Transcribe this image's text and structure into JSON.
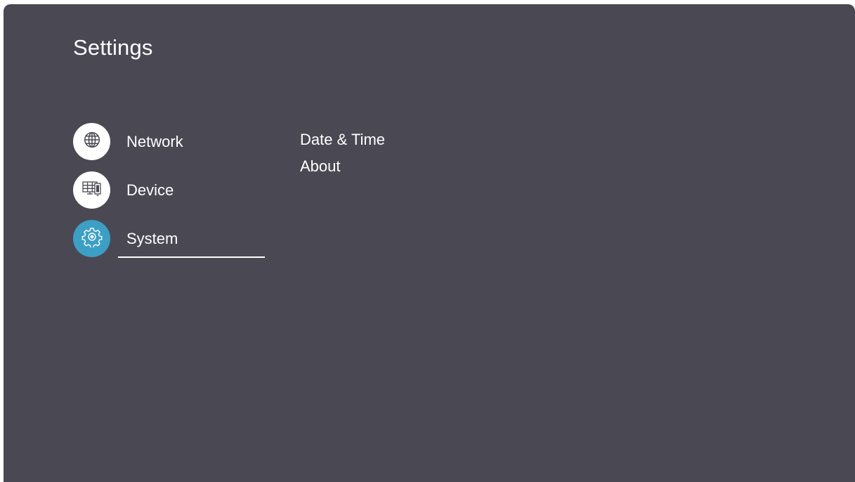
{
  "header": {
    "title": "Settings"
  },
  "nav": {
    "items": [
      {
        "label": "Network",
        "icon": "globe-icon",
        "active": false
      },
      {
        "label": "Device",
        "icon": "display-device-icon",
        "active": false
      },
      {
        "label": "System",
        "icon": "gear-icon",
        "active": true
      }
    ]
  },
  "submenu": {
    "items": [
      {
        "label": "Date & Time"
      },
      {
        "label": "About"
      }
    ]
  },
  "colors": {
    "background": "#4a4953",
    "accent": "#3c9fc6",
    "text": "#ffffff"
  }
}
